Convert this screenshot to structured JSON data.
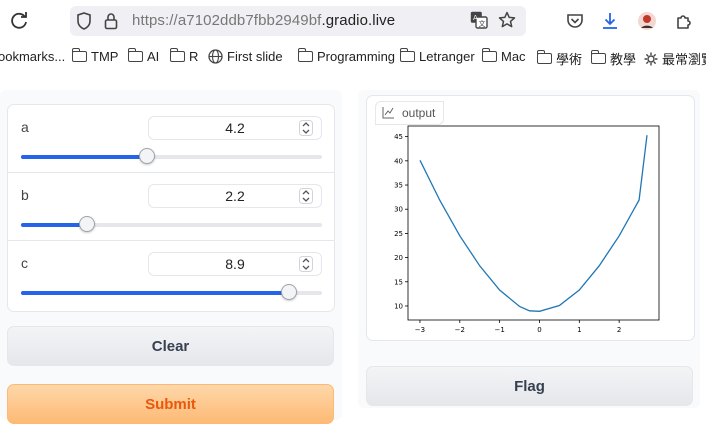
{
  "browser": {
    "url_prefix": "https://",
    "url_domain_part": "a7102ddb7fbb2949bf",
    "url_suffix": ".gradio.live",
    "bookmarks": [
      {
        "label": "ookmarks...",
        "icon": "none"
      },
      {
        "label": "TMP",
        "icon": "folder-icon"
      },
      {
        "label": "AI",
        "icon": "folder-icon"
      },
      {
        "label": "R",
        "icon": "folder-icon"
      },
      {
        "label": "First slide",
        "icon": "globe-icon"
      },
      {
        "label": "Programming",
        "icon": "folder-icon"
      },
      {
        "label": "Letranger",
        "icon": "folder-icon"
      },
      {
        "label": "Mac",
        "icon": "folder-icon"
      },
      {
        "label": "學術",
        "icon": "folder-icon"
      },
      {
        "label": "教學",
        "icon": "folder-icon"
      },
      {
        "label": "最常瀏覽",
        "icon": "gear-icon"
      }
    ]
  },
  "inputs": {
    "a": {
      "label": "a",
      "value": "4.2",
      "fraction": 0.42
    },
    "b": {
      "label": "b",
      "value": "2.2",
      "fraction": 0.22
    },
    "c": {
      "label": "c",
      "value": "8.9",
      "fraction": 0.89
    }
  },
  "buttons": {
    "clear": "Clear",
    "submit": "Submit",
    "flag": "Flag"
  },
  "output": {
    "label": "output",
    "chart_data": {
      "type": "line",
      "x": [
        -3.0,
        -2.5,
        -2.0,
        -1.5,
        -1.0,
        -0.5,
        -0.25,
        0.0,
        0.5,
        1.0,
        1.5,
        2.0,
        2.5,
        2.7
      ],
      "y": [
        40.1,
        31.8,
        24.5,
        18.3,
        13.3,
        9.9,
        9.0,
        8.9,
        10.1,
        13.3,
        18.3,
        24.5,
        31.9,
        45.3
      ],
      "xticks": [
        "-3",
        "-2",
        "-1",
        "0",
        "1",
        "2"
      ],
      "yticks": [
        "10",
        "15",
        "20",
        "25",
        "30",
        "35",
        "40",
        "45"
      ],
      "xlim": [
        -3.3,
        3.0
      ],
      "ylim": [
        7.1,
        47.2
      ],
      "line_color": "#1f77b4",
      "grid": false
    }
  }
}
